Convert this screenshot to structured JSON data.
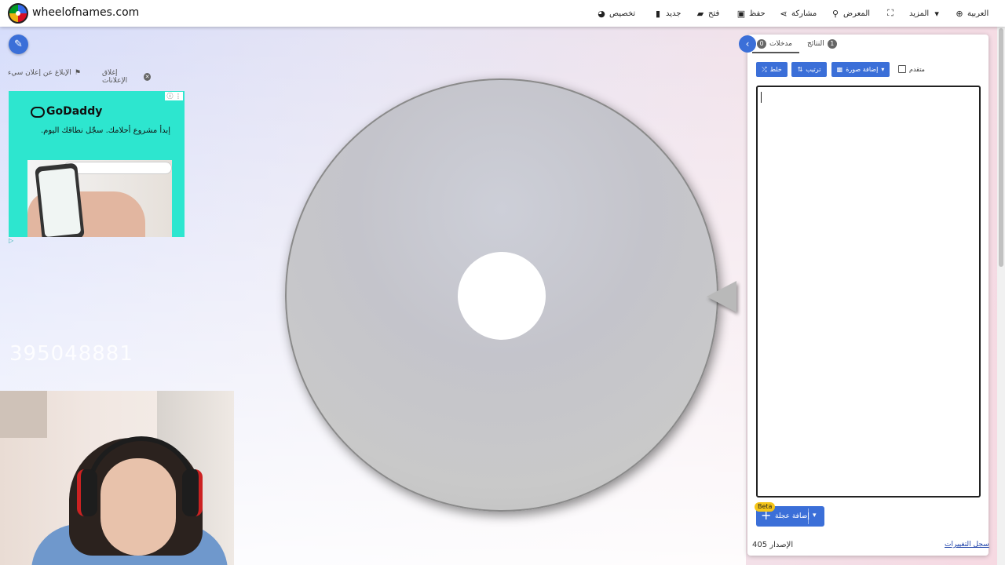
{
  "header": {
    "site_name": "wheelofnames.com",
    "nav": {
      "customize": "تخصيص",
      "new": "جديد",
      "open": "فتح",
      "save": "حفظ",
      "share": "مشاركة",
      "gallery": "المعرض",
      "more": "المزيد",
      "language": "العربية"
    }
  },
  "ads": {
    "report_label": "الإبلاغ عن إعلان سيء",
    "close_label": "إغلاق الإعلانات",
    "brand": "GoDaddy",
    "tagline": "إبدأ مشروع أحلامك. سجّل نطاقك اليوم."
  },
  "overlay": {
    "ghost_number": "395048881"
  },
  "panel": {
    "tabs": [
      {
        "label": "مدخلات",
        "count": "0"
      },
      {
        "label": "النتائج",
        "count": "1"
      }
    ],
    "buttons": {
      "shuffle": "خلط",
      "sort": "ترتيب",
      "add_image": "إضافة صورة"
    },
    "advanced_label": "متقدم",
    "add_wheel_label": "إضافة عجلة",
    "beta_label": "Beta",
    "version": "الإصدار 405",
    "changelog": "سجل التغييرات"
  },
  "colors": {
    "accent": "#3b6fd8",
    "ad_background": "#2de6cf"
  },
  "icons": {
    "customize": "palette-icon",
    "new": "file-icon",
    "open": "folder-open-icon",
    "save": "floppy-disk-icon",
    "share": "share-icon",
    "gallery": "search-icon",
    "fullscreen": "expand-icon",
    "more": "caret-down-icon",
    "language": "globe-icon"
  }
}
